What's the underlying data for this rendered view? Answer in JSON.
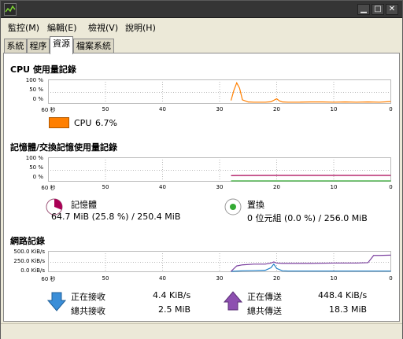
{
  "window": {
    "icon": "system-monitor-icon"
  },
  "menubar": [
    "監控(M)",
    "編輯(E)",
    "檢視(V)",
    "說明(H)"
  ],
  "tabs": [
    "系統",
    "程序",
    "資源",
    "檔案系統"
  ],
  "active_tab": "資源",
  "cpu": {
    "title": "CPU 使用量記錄",
    "y_ticks": [
      "100 %",
      "50 %",
      "0 %"
    ],
    "x_ticks": [
      "60 秒",
      "50",
      "40",
      "30",
      "20",
      "10",
      "0"
    ],
    "legend_label": "CPU",
    "legend_value": "6.7%",
    "color": "#ff7f00"
  },
  "memory": {
    "title": "記憶體/交換記憶使用量記錄",
    "y_ticks": [
      "100 %",
      "50 %",
      "0 %"
    ],
    "x_ticks": [
      "60 秒",
      "50",
      "40",
      "30",
      "20",
      "10",
      "0"
    ],
    "mem_label": "記憶體",
    "mem_value": "64.7 MiB (25.8 %) / 250.4 MiB",
    "mem_color": "#aa0055",
    "swap_label": "置換",
    "swap_value": "0 位元組 (0.0 %) / 256.0 MiB",
    "swap_color": "#33aa33"
  },
  "network": {
    "title": "網路記錄",
    "y_ticks": [
      "500.0 KiB/s",
      "250.0 KiB/s",
      "0.0 KiB/s"
    ],
    "x_ticks": [
      "60 秒",
      "50",
      "40",
      "30",
      "20",
      "10",
      "0"
    ],
    "recv_label": "正在接收",
    "recv_value": "4.4 KiB/s",
    "recv_total_label": "總共接收",
    "recv_total_value": "2.5 MiB",
    "recv_color": "#1f7fc7",
    "send_label": "正在傳送",
    "send_value": "448.4 KiB/s",
    "send_total_label": "總共傳送",
    "send_total_value": "18.3 MiB",
    "send_color": "#7b3f9f"
  },
  "chart_data": [
    {
      "type": "line",
      "title": "CPU 使用量記錄",
      "xlabel": "",
      "ylabel": "",
      "xlim": [
        60,
        0
      ],
      "ylim": [
        0,
        100
      ],
      "series": [
        {
          "name": "CPU",
          "x": [
            28,
            27.5,
            27,
            26.5,
            26,
            25,
            24,
            22,
            21,
            20,
            19.5,
            19,
            18,
            16,
            14,
            12,
            10,
            8,
            6,
            4,
            2,
            0
          ],
          "values": [
            12,
            60,
            95,
            70,
            15,
            5,
            4,
            4,
            6,
            20,
            10,
            5,
            4,
            4,
            5,
            5,
            4,
            5,
            4,
            5,
            4,
            7
          ]
        }
      ]
    },
    {
      "type": "line",
      "title": "記憶體/交換記憶使用量記錄",
      "xlabel": "",
      "ylabel": "",
      "xlim": [
        60,
        0
      ],
      "ylim": [
        0,
        100
      ],
      "series": [
        {
          "name": "記憶體",
          "x": [
            28,
            27,
            20,
            10,
            0
          ],
          "values": [
            25,
            25.5,
            25.8,
            25.8,
            25.8
          ]
        },
        {
          "name": "置換",
          "x": [
            28,
            20,
            10,
            0
          ],
          "values": [
            0,
            0,
            0,
            0
          ]
        }
      ]
    },
    {
      "type": "line",
      "title": "網路記錄",
      "xlabel": "",
      "ylabel": "",
      "xlim": [
        60,
        0
      ],
      "ylim": [
        0,
        500
      ],
      "series": [
        {
          "name": "正在接收",
          "x": [
            28,
            26,
            24,
            22,
            21,
            20.5,
            20,
            19,
            18,
            14,
            10,
            6,
            2,
            0
          ],
          "values": [
            0,
            15,
            20,
            30,
            100,
            200,
            80,
            15,
            10,
            10,
            10,
            10,
            10,
            10
          ]
        },
        {
          "name": "正在傳送",
          "x": [
            28,
            27,
            26,
            24,
            22,
            21,
            20.5,
            20,
            19,
            18,
            14,
            10,
            6,
            4,
            3,
            2,
            0
          ],
          "values": [
            0,
            150,
            180,
            200,
            200,
            230,
            260,
            230,
            220,
            220,
            220,
            230,
            230,
            240,
            440,
            440,
            448
          ]
        }
      ]
    }
  ]
}
